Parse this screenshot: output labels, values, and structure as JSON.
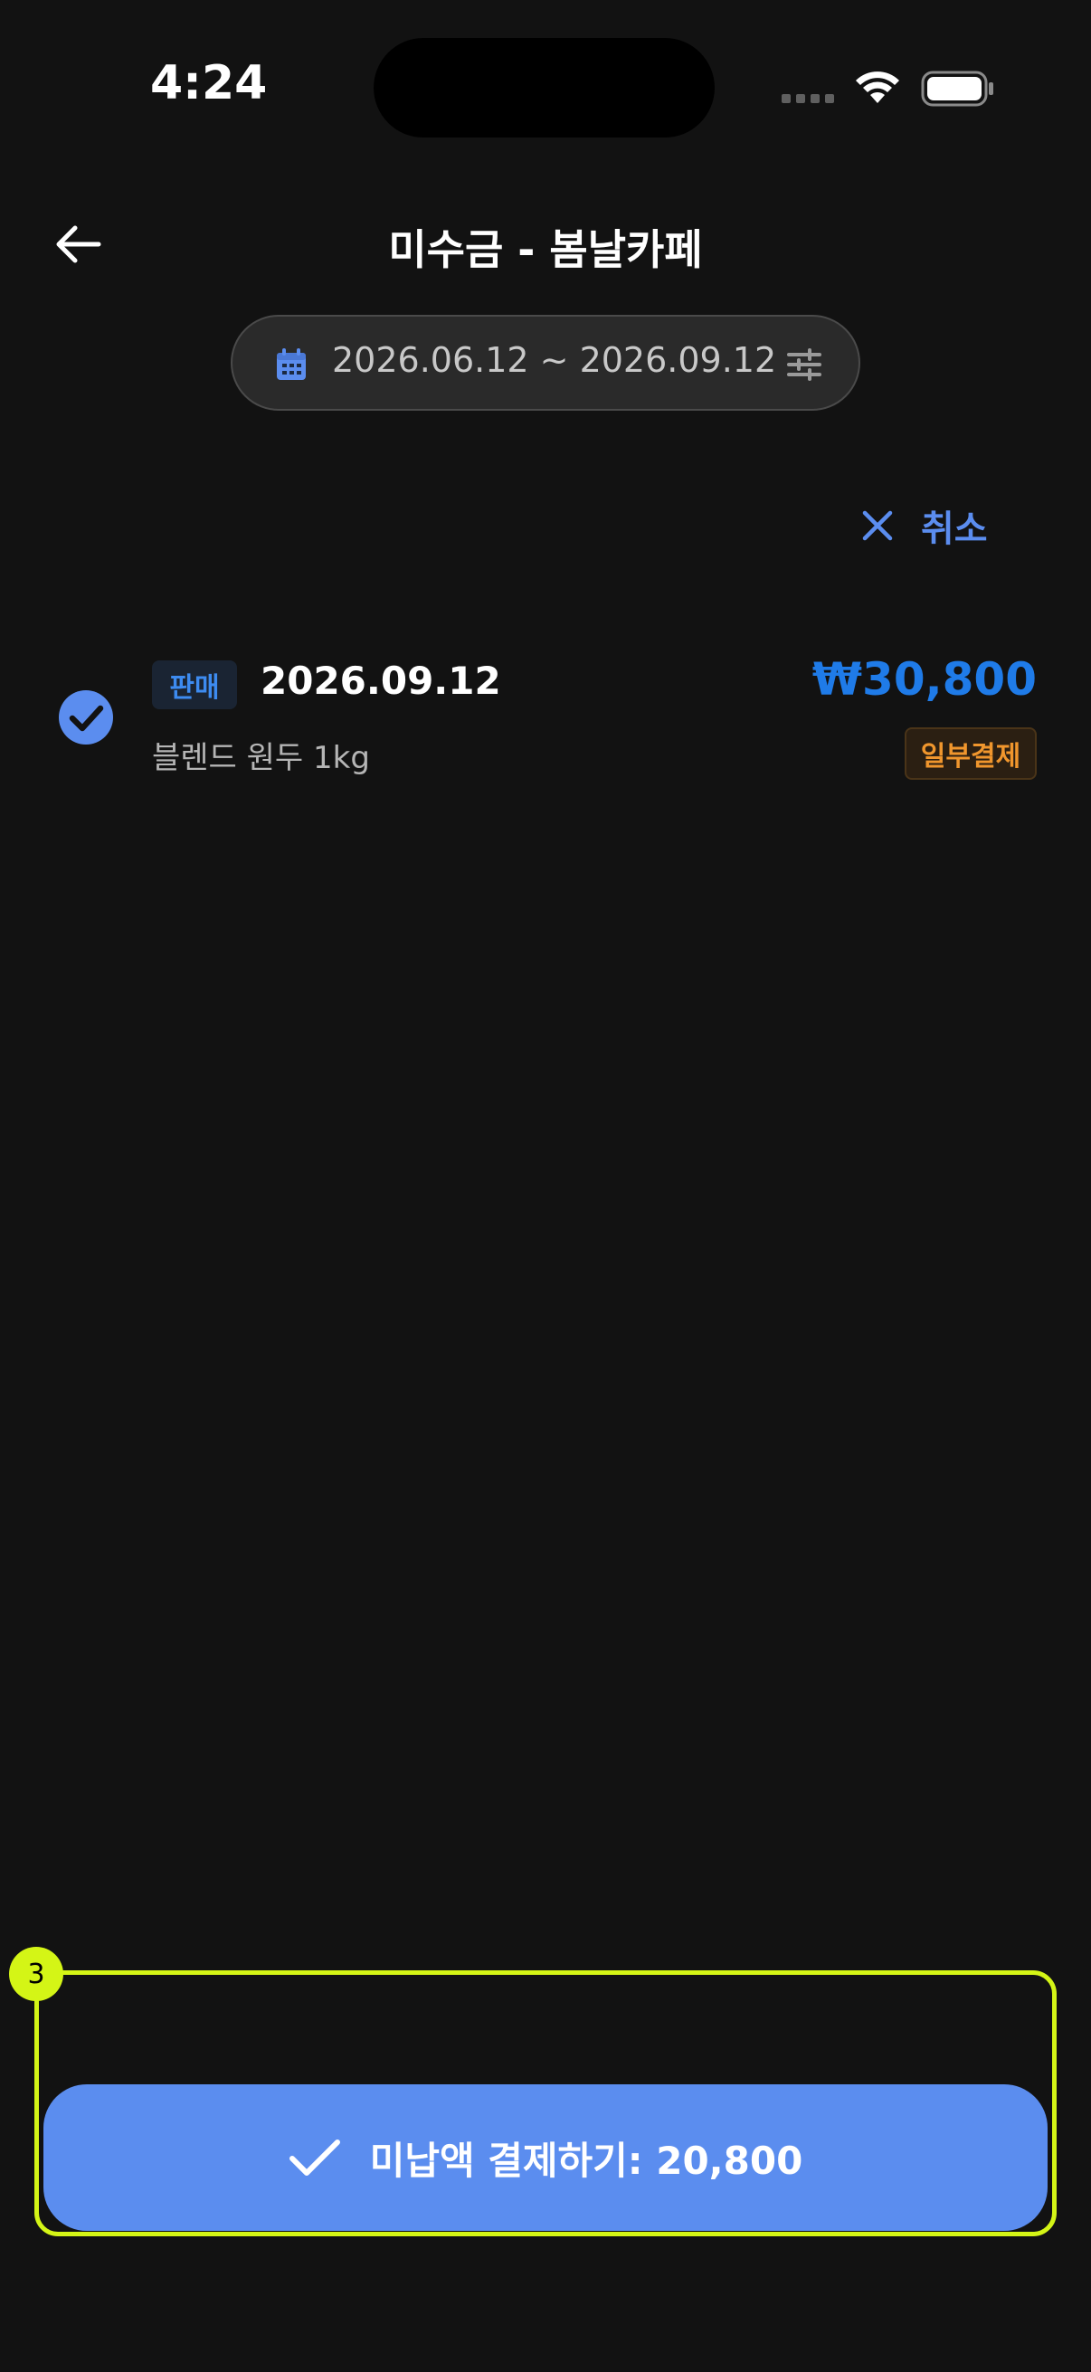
{
  "status_bar": {
    "time": "4:24"
  },
  "header": {
    "title": "미수금 - 봄날카페"
  },
  "filter": {
    "date_range": "2026.06.12 ~ 2026.09.12"
  },
  "actions": {
    "cancel_label": "취소"
  },
  "items": [
    {
      "type_label": "판매",
      "date": "2026.09.12",
      "description": "블렌드 원두 1kg",
      "amount": "₩30,800",
      "status": "일부결제",
      "selected": true
    }
  ],
  "bottom": {
    "box_number": "3",
    "pay_button_label": "미납액 결제하기: 20,800"
  },
  "colors": {
    "background": "#121212",
    "accent": "#5b8def",
    "amount": "#1f7be8",
    "partial_status": "#f0962d",
    "highlight": "#d4f516"
  }
}
